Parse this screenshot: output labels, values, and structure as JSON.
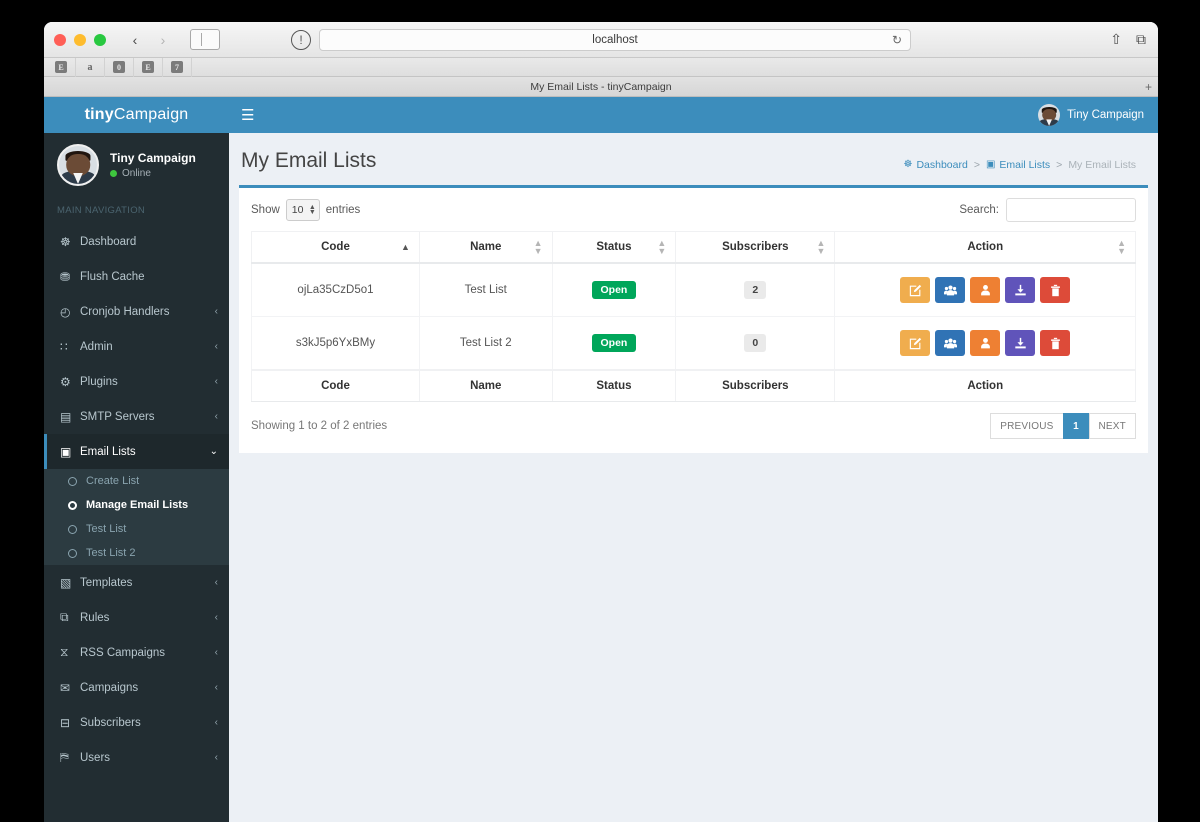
{
  "browser": {
    "url": "localhost",
    "tab_title": "My Email Lists - tinyCampaign",
    "back_icon": "‹",
    "forward_icon": "›",
    "shield_icon": "!",
    "reload_icon": "↻",
    "share_icon": "⇧",
    "tabs_icon": "⧉",
    "new_tab_icon": "+",
    "bookmarks": [
      {
        "label": "E",
        "name": "bookmark-e1"
      },
      {
        "label": "a",
        "name": "bookmark-amazon"
      },
      {
        "label": "0",
        "name": "bookmark-zero"
      },
      {
        "label": "E",
        "name": "bookmark-e2"
      },
      {
        "label": "7",
        "name": "bookmark-seven"
      }
    ]
  },
  "navbar": {
    "logo_bold": "tiny",
    "logo_light": "Campaign",
    "hamburger_icon": "☰",
    "user_name": "Tiny Campaign"
  },
  "sidebar": {
    "user_name": "Tiny Campaign",
    "user_status": "Online",
    "nav_header": "MAIN NAVIGATION",
    "items": [
      {
        "label": "Dashboard",
        "icon": "☸",
        "icon_name": "dashboard-icon",
        "arrow": "",
        "active": false
      },
      {
        "label": "Flush Cache",
        "icon": "⛃",
        "icon_name": "database-icon",
        "arrow": "",
        "active": false
      },
      {
        "label": "Cronjob Handlers",
        "icon": "◴",
        "icon_name": "clock-icon",
        "arrow": "‹",
        "active": false
      },
      {
        "label": "Admin",
        "icon": "∷",
        "icon_name": "grid-icon",
        "arrow": "‹",
        "active": false
      },
      {
        "label": "Plugins",
        "icon": "⚙",
        "icon_name": "gear-icon",
        "arrow": "‹",
        "active": false
      },
      {
        "label": "SMTP Servers",
        "icon": "▤",
        "icon_name": "server-icon",
        "arrow": "‹",
        "active": false
      },
      {
        "label": "Email Lists",
        "icon": "▣",
        "icon_name": "list-icon",
        "arrow": "⌄",
        "active": true
      },
      {
        "label": "Templates",
        "icon": "▧",
        "icon_name": "file-icon",
        "arrow": "‹",
        "active": false
      },
      {
        "label": "Rules",
        "icon": "⧉",
        "icon_name": "rules-icon",
        "arrow": "‹",
        "active": false
      },
      {
        "label": "RSS Campaigns",
        "icon": "⧖",
        "icon_name": "rss-icon",
        "arrow": "‹",
        "active": false
      },
      {
        "label": "Campaigns",
        "icon": "✉",
        "icon_name": "envelope-icon",
        "arrow": "‹",
        "active": false
      },
      {
        "label": "Subscribers",
        "icon": "⊟",
        "icon_name": "subscribers-icon",
        "arrow": "‹",
        "active": false
      },
      {
        "label": "Users",
        "icon": "⛿",
        "icon_name": "users-icon",
        "arrow": "‹",
        "active": false
      }
    ],
    "submenu": [
      {
        "label": "Create List",
        "current": false
      },
      {
        "label": "Manage Email Lists",
        "current": true
      },
      {
        "label": "Test List",
        "current": false
      },
      {
        "label": "Test List 2",
        "current": false
      }
    ]
  },
  "page": {
    "title": "My Email Lists",
    "breadcrumb": [
      {
        "label": "Dashboard",
        "icon": "☸",
        "current": false
      },
      {
        "label": "Email Lists",
        "icon": "▣",
        "current": false
      },
      {
        "label": "My Email Lists",
        "icon": "",
        "current": true
      }
    ],
    "breadcrumb_sep": ">"
  },
  "table_controls": {
    "show_label": "Show",
    "entries_label": "entries",
    "entries_value": "10",
    "search_label": "Search:",
    "search_value": "",
    "search_placeholder": ""
  },
  "table": {
    "columns": [
      {
        "label": "Code",
        "sorted": "asc"
      },
      {
        "label": "Name",
        "sorted": ""
      },
      {
        "label": "Status",
        "sorted": ""
      },
      {
        "label": "Subscribers",
        "sorted": ""
      },
      {
        "label": "Action",
        "sorted": ""
      }
    ],
    "rows": [
      {
        "code": "ojLa35CzD5o1",
        "name": "Test List",
        "status": "Open",
        "subscribers": "2"
      },
      {
        "code": "s3kJ5p6YxBMy",
        "name": "Test List 2",
        "status": "Open",
        "subscribers": "0"
      }
    ],
    "actions": [
      {
        "name": "edit-list-button",
        "color": "#f0ad4e",
        "icon": "edit-icon"
      },
      {
        "name": "view-subscribers-button",
        "color": "#3073b5",
        "icon": "users-icon"
      },
      {
        "name": "import-subscribers-button",
        "color": "#ee8033",
        "icon": "user-upload-icon"
      },
      {
        "name": "export-list-button",
        "color": "#6054ba",
        "icon": "download-icon"
      },
      {
        "name": "delete-list-button",
        "color": "#dd4b39",
        "icon": "trash-icon"
      }
    ]
  },
  "footer": {
    "info": "Showing 1 to 2 of 2 entries",
    "pagination": [
      {
        "label": "PREVIOUS",
        "active": false,
        "name": "pagination-previous"
      },
      {
        "label": "1",
        "active": true,
        "name": "pagination-page-1"
      },
      {
        "label": "NEXT",
        "active": false,
        "name": "pagination-next"
      }
    ]
  },
  "colors": {
    "brand_blue": "#3c8dbc",
    "sidebar_dark": "#222d32",
    "status_green": "#00a65a",
    "page_bg": "#ecf0f5"
  }
}
